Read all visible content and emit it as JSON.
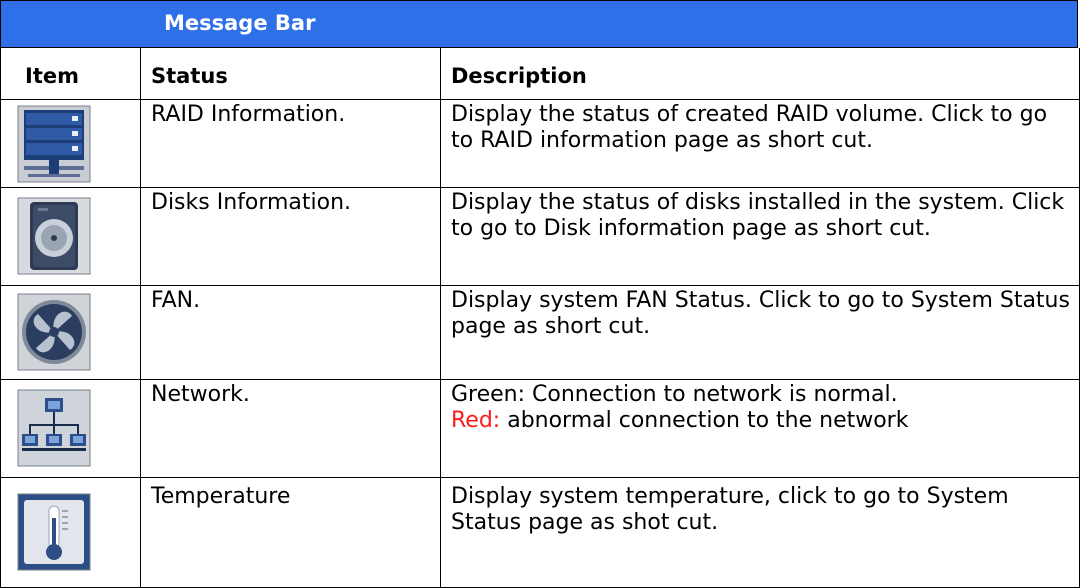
{
  "header": {
    "title": "Message Bar"
  },
  "columns": {
    "item": "Item",
    "status": "Status",
    "description": "Description"
  },
  "rows": [
    {
      "icon": "raid-storage-icon",
      "status": "RAID Information.",
      "description": "Display the status of created RAID volume. Click to go to RAID information page as short cut."
    },
    {
      "icon": "disk-drive-icon",
      "status": "Disks Information.",
      "description": "Display the status of disks installed in the system. Click to go to Disk information page as short cut."
    },
    {
      "icon": "fan-icon",
      "status": "FAN.",
      "description": "Display system FAN Status. Click to go to System Status page as short cut."
    },
    {
      "icon": "network-icon",
      "status": "Network.",
      "description_green": "Green: Connection to network is normal.",
      "description_red_label": "Red:",
      "description_red_text": " abnormal connection to the network"
    },
    {
      "icon": "thermometer-icon",
      "status": "Temperature",
      "description": "Display system temperature, click to go to System Status page as shot cut."
    }
  ],
  "colors": {
    "header_bg": "#2f6fe8",
    "header_text": "#ffffff",
    "red_label": "#ff1a1a"
  }
}
